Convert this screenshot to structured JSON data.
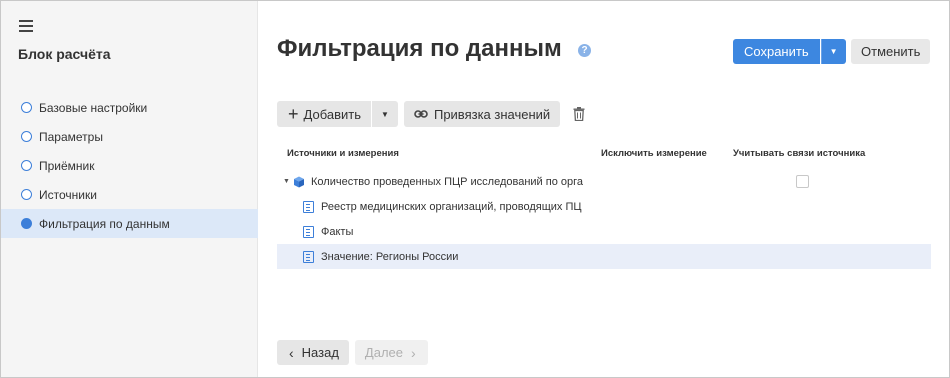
{
  "sidebar": {
    "title": "Блок расчёта",
    "steps": [
      {
        "label": "Базовые настройки",
        "active": false
      },
      {
        "label": "Параметры",
        "active": false
      },
      {
        "label": "Приёмник",
        "active": false
      },
      {
        "label": "Источники",
        "active": false
      },
      {
        "label": "Фильтрация по данным",
        "active": true
      }
    ]
  },
  "header": {
    "title": "Фильтрация по данным",
    "help": "?",
    "save_label": "Сохранить",
    "cancel_label": "Отменить"
  },
  "toolbar": {
    "add_label": "Добавить",
    "bind_label": "Привязка значений"
  },
  "grid": {
    "columns": [
      "Источники и измерения",
      "Исключить измерение",
      "Учитывать связи источника"
    ],
    "rows": [
      {
        "text": "Количество проведенных ПЦР исследований по орга",
        "level": 0,
        "icon": "cube-icon",
        "has_checkbox": true,
        "selected": false
      },
      {
        "text": "Реестр медицинских организаций, проводящих ПЦ",
        "level": 1,
        "icon": "dimension-icon",
        "has_checkbox": false,
        "selected": false
      },
      {
        "text": "Факты",
        "level": 1,
        "icon": "dimension-icon",
        "has_checkbox": false,
        "selected": false
      },
      {
        "text": "Значение: Регионы России",
        "level": 1,
        "icon": "dimension-icon",
        "has_checkbox": false,
        "selected": true
      }
    ]
  },
  "footer": {
    "back_label": "Назад",
    "next_label": "Далее"
  },
  "colors": {
    "accent": "#3d87e0",
    "sidebar_bg": "#f5f5f5",
    "active_step_bg": "#dce8f8",
    "selected_row_bg": "#e9eef9"
  }
}
